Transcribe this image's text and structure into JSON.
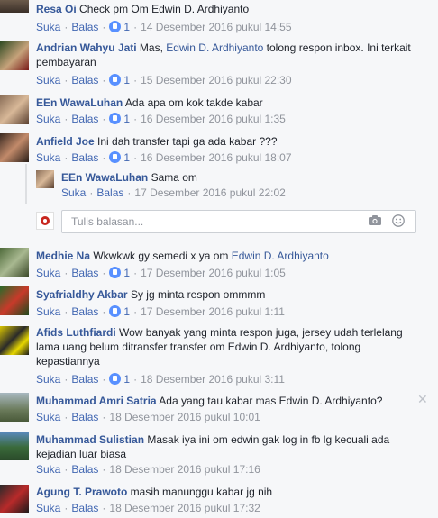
{
  "ui": {
    "like_label": "Suka",
    "reply_label": "Balas",
    "reply_placeholder": "Tulis balasan..."
  },
  "comments": [
    {
      "name": "Resa Oi",
      "text": "Check pm Om Edwin D. Ardhiyanto",
      "likes": "1",
      "time": "14 Desember 2016 pukul 14:55"
    },
    {
      "name": "Andrian Wahyu Jati",
      "pre": "Mas, ",
      "mention": "Edwin D. Ardhiyanto",
      "post": " tolong respon inbox. Ini terkait pembayaran",
      "likes": "1",
      "time": "15 Desember 2016 pukul 22:30"
    },
    {
      "name": "EEn WawaLuhan",
      "text": "Ada apa om kok takde kabar",
      "likes": "1",
      "time": "16 Desember 2016 pukul 1:35"
    },
    {
      "name": "Anfield Joe",
      "text": "Ini dah transfer tapi ga ada kabar ???",
      "likes": "1",
      "time": "16 Desember 2016 pukul 18:07"
    },
    {
      "name": "EEn WawaLuhan",
      "text": "Sama om",
      "time": "17 Desember 2016 pukul 22:02"
    },
    {
      "name": "Medhie Na",
      "pre": "Wkwkwk gy semedi x ya om ",
      "mention": "Edwin D. Ardhiyanto",
      "likes": "1",
      "time": "17 Desember 2016 pukul 1:05"
    },
    {
      "name": "Syafrialdhy Akbar",
      "text": "Sy jg minta respon ommmm",
      "likes": "1",
      "time": "17 Desember 2016 pukul 1:11"
    },
    {
      "name": "Afids Luthfiardi",
      "text": "Wow banyak yang minta respon juga, jersey udah terlelang lama uang belum ditransfer transfer om Edwin D. Ardhiyanto, tolong kepastiannya",
      "likes": "1",
      "time": "18 Desember 2016 pukul 3:11"
    },
    {
      "name": "Muhammad Amri Satria",
      "text": "Ada yang tau kabar mas Edwin D. Ardhiyanto?",
      "time": "18 Desember 2016 pukul 10:01"
    },
    {
      "name": "Muhammad Sulistian",
      "text": "Masak iya ini om edwin gak log in fb lg kecuali ada kejadian luar biasa",
      "time": "18 Desember 2016 pukul 17:16"
    },
    {
      "name": "Agung T. Prawoto",
      "text": "masih manunggu kabar jg nih",
      "time": "18 Desember 2016 pukul 17:32"
    }
  ],
  "colors": {
    "link": "#365899",
    "meta": "#90949c",
    "like_badge": "#5890ff",
    "background": "#f6f7f9"
  }
}
